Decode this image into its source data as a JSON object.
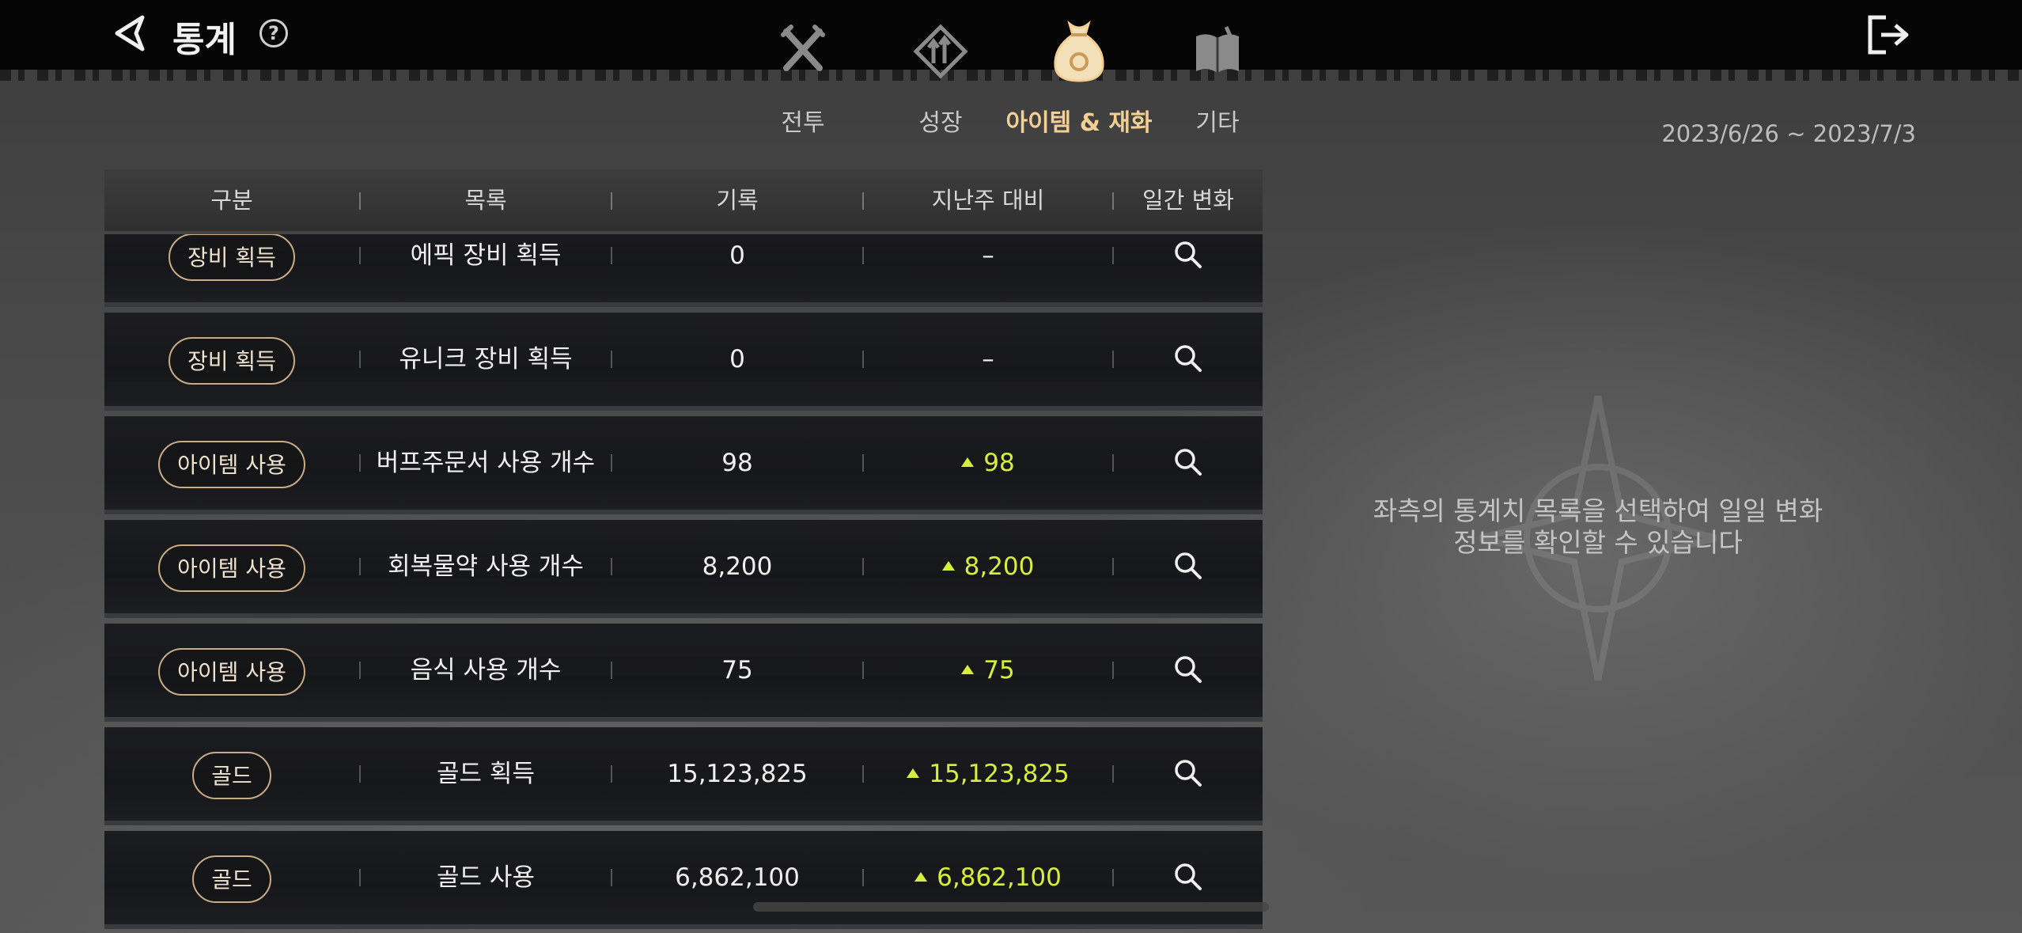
{
  "header": {
    "title": "통계",
    "back_icon": "back-arrow-icon",
    "help_label": "?",
    "exit_icon": "exit-icon"
  },
  "tabs": [
    {
      "label": "전투",
      "icon": "crossed-swords-icon",
      "active": false
    },
    {
      "label": "성장",
      "icon": "growth-arrows-icon",
      "active": false
    },
    {
      "label": "아이템 & 재화",
      "icon": "money-bag-icon",
      "active": true
    },
    {
      "label": "기타",
      "icon": "book-icon",
      "active": false
    }
  ],
  "date_range": "2023/6/26 ~ 2023/7/3",
  "table": {
    "headers": [
      "구분",
      "목록",
      "기록",
      "지난주 대비",
      "일간 변화"
    ],
    "rows": [
      {
        "category": "장비 획득",
        "item": "에픽 장비 획득",
        "record": "0",
        "change": "–",
        "up": false
      },
      {
        "category": "장비 획득",
        "item": "유니크 장비 획득",
        "record": "0",
        "change": "–",
        "up": false
      },
      {
        "category": "아이템 사용",
        "item": "버프주문서 사용 개수",
        "record": "98",
        "change": "98",
        "up": true
      },
      {
        "category": "아이템 사용",
        "item": "회복물약 사용 개수",
        "record": "8,200",
        "change": "8,200",
        "up": true
      },
      {
        "category": "아이템 사용",
        "item": "음식 사용 개수",
        "record": "75",
        "change": "75",
        "up": true
      },
      {
        "category": "골드",
        "item": "골드 획득",
        "record": "15,123,825",
        "change": "15,123,825",
        "up": true
      },
      {
        "category": "골드",
        "item": "골드 사용",
        "record": "6,862,100",
        "change": "6,862,100",
        "up": true
      }
    ]
  },
  "hint": {
    "line1": "좌측의 통계치 목록을 선택하여 일일 변화",
    "line2": "정보를 확인할 수 있습니다"
  },
  "colors": {
    "accent_tab": "#f3cf93",
    "increase": "#d7ef3a",
    "pill_border": "#c9ad86"
  }
}
